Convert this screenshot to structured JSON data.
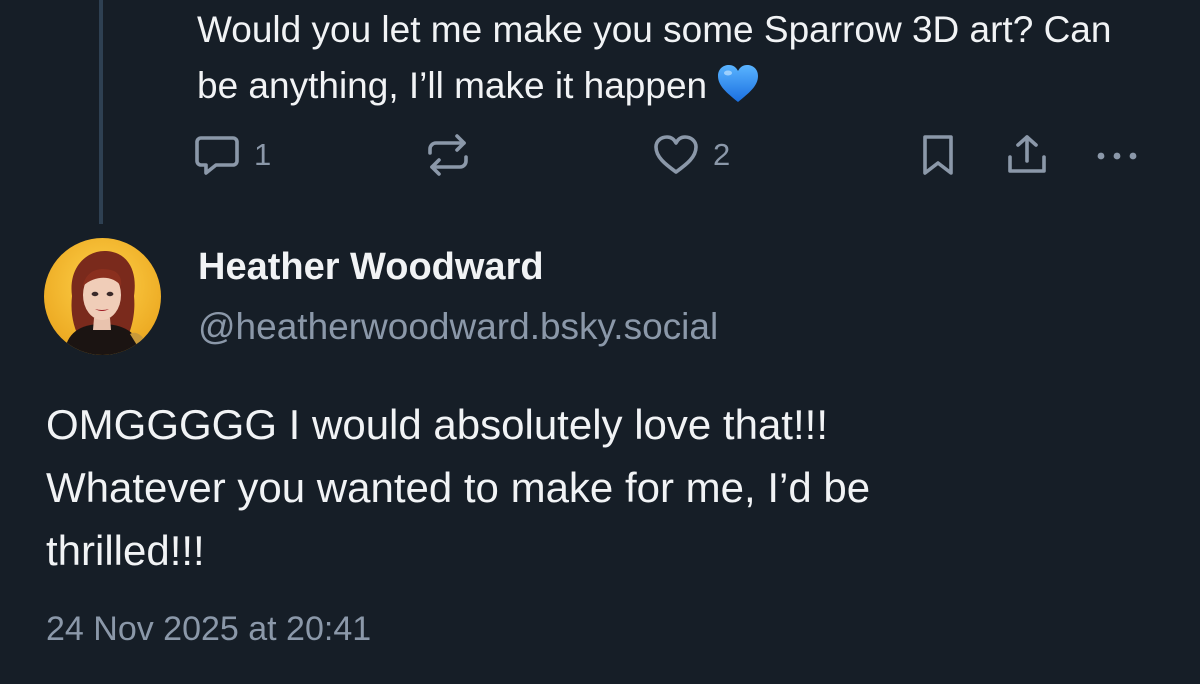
{
  "parent_post": {
    "text": "Would you let me make you some Sparrow 3D art? Can be anything, I’ll make it happen",
    "emoji": "blue-heart-emoji",
    "actions": {
      "reply_count": "1",
      "like_count": "2"
    }
  },
  "reply_post": {
    "author": {
      "display_name": "Heather Woodward",
      "handle": "@heatherwoodward.bsky.social"
    },
    "text_lines": [
      "OMGGGGG I would absolutely love that!!!",
      "Whatever you wanted to make for me, I’d be",
      "thrilled!!!"
    ],
    "timestamp": "24 Nov 2025 at 20:41"
  },
  "icons": {
    "reply": "speech-bubble-icon",
    "repost": "repost-arrows-icon",
    "like": "heart-outline-icon",
    "bookmark": "bookmark-icon",
    "share": "share-upload-icon",
    "more": "ellipsis-icon"
  },
  "colors": {
    "background": "#161e27",
    "text_primary": "#f1f3f5",
    "text_secondary": "#8b98a9",
    "thread_line": "#2e4052",
    "emoji_blue": "#2f8bf0",
    "avatar_background": "#f2b830"
  }
}
